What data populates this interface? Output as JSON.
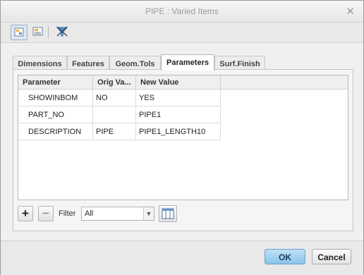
{
  "window": {
    "title": "PIPE : Varied Items",
    "close_glyph": "✕"
  },
  "toolbar": {
    "icons": [
      "varied-items-view-icon",
      "layout-icon",
      "filter-clear-icon"
    ]
  },
  "tabs": [
    {
      "label": "Dimensions",
      "active": false
    },
    {
      "label": "Features",
      "active": false
    },
    {
      "label": "Geom.Tols",
      "active": false
    },
    {
      "label": "Parameters",
      "active": true
    },
    {
      "label": "Surf.Finish",
      "active": false
    }
  ],
  "table": {
    "headers": [
      "Parameter",
      "Orig Va...",
      "New Value"
    ],
    "rows": [
      {
        "parameter": "SHOWINBOM",
        "orig": "NO",
        "new": "YES"
      },
      {
        "parameter": "PART_NO",
        "orig": "",
        "new": "PIPE1"
      },
      {
        "parameter": "DESCRIPTION",
        "orig": "PIPE",
        "new": "PIPE1_LENGTH10"
      }
    ]
  },
  "bottom": {
    "add_glyph": "+",
    "remove_glyph": "−",
    "filter_label": "Filter",
    "filter_value": "All",
    "arrow_glyph": "▼"
  },
  "footer": {
    "ok": "OK",
    "cancel": "Cancel"
  }
}
